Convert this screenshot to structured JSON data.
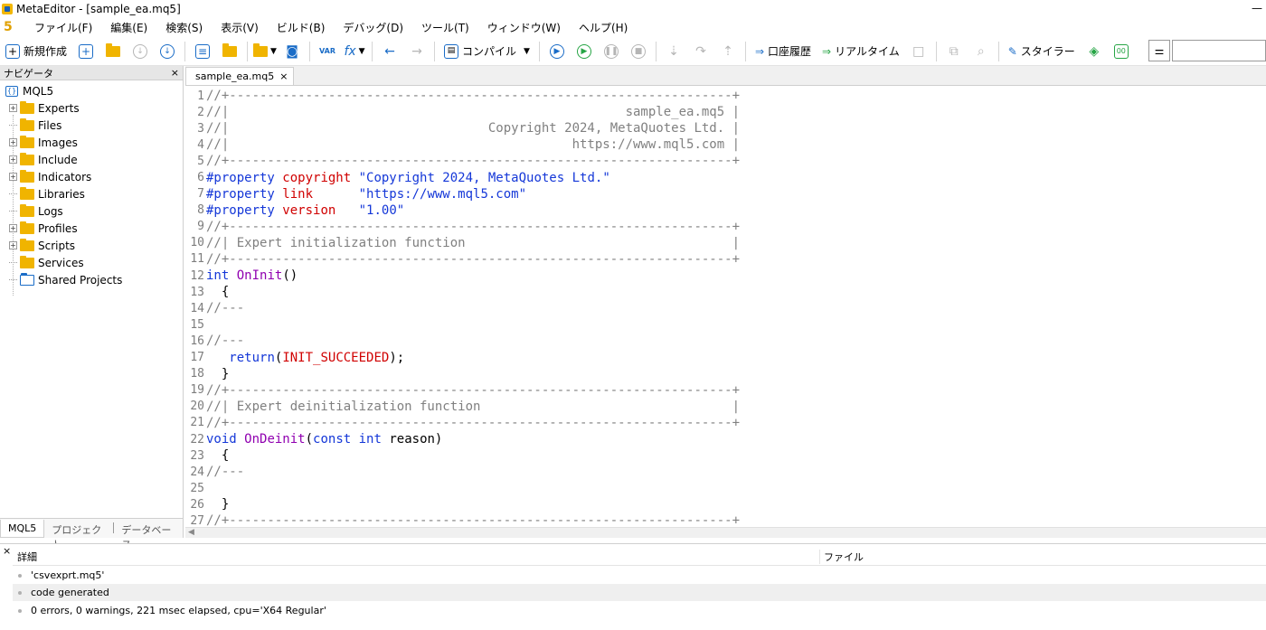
{
  "window": {
    "title": "MetaEditor - [sample_ea.mq5]",
    "minimize": "—"
  },
  "menu": [
    "ファイル(F)",
    "編集(E)",
    "検索(S)",
    "表示(V)",
    "ビルド(B)",
    "デバッグ(D)",
    "ツール(T)",
    "ウィンドウ(W)",
    "ヘルプ(H)"
  ],
  "menu_logo": "5",
  "toolbar": {
    "new_label": "新規作成",
    "compile_label": "コンパイル",
    "history_label": "口座履歴",
    "realtime_label": "リアルタイム",
    "styler_label": "スタイラー",
    "var_label": "VAR",
    "fx_label": "fx"
  },
  "navigator": {
    "title": "ナビゲータ",
    "close": "×",
    "root": "MQL5",
    "items": [
      {
        "label": "Experts",
        "expandable": true
      },
      {
        "label": "Files",
        "expandable": false
      },
      {
        "label": "Images",
        "expandable": true
      },
      {
        "label": "Include",
        "expandable": true
      },
      {
        "label": "Indicators",
        "expandable": true
      },
      {
        "label": "Libraries",
        "expandable": false
      },
      {
        "label": "Logs",
        "expandable": false
      },
      {
        "label": "Profiles",
        "expandable": true
      },
      {
        "label": "Scripts",
        "expandable": true
      },
      {
        "label": "Services",
        "expandable": false
      },
      {
        "label": "Shared Projects",
        "expandable": false
      }
    ],
    "tabs": [
      "MQL5",
      "プロジェクト",
      "データベース"
    ]
  },
  "editor": {
    "tab": "sample_ea.mq5",
    "tab_close": "×",
    "lines": [
      {
        "n": "1",
        "t": [
          [
            "c-comment",
            "//+------------------------------------------------------------------+"
          ]
        ]
      },
      {
        "n": "2",
        "t": [
          [
            "c-comment",
            "//|                                                    sample_ea.mq5 |"
          ]
        ]
      },
      {
        "n": "3",
        "t": [
          [
            "c-comment",
            "//|                                  Copyright 2024, MetaQuotes Ltd. |"
          ]
        ]
      },
      {
        "n": "4",
        "t": [
          [
            "c-comment",
            "//|                                             https://www.mql5.com |"
          ]
        ]
      },
      {
        "n": "5",
        "t": [
          [
            "c-comment",
            "//+------------------------------------------------------------------+"
          ]
        ]
      },
      {
        "n": "6",
        "t": [
          [
            "c-pp",
            "#property"
          ],
          [
            "lc",
            " "
          ],
          [
            "c-prop",
            "copyright"
          ],
          [
            "lc",
            " "
          ],
          [
            "c-str",
            "\"Copyright 2024, MetaQuotes Ltd.\""
          ]
        ]
      },
      {
        "n": "7",
        "t": [
          [
            "c-pp",
            "#property"
          ],
          [
            "lc",
            " "
          ],
          [
            "c-prop",
            "link"
          ],
          [
            "lc",
            "      "
          ],
          [
            "c-str",
            "\"https://www.mql5.com\""
          ]
        ]
      },
      {
        "n": "8",
        "t": [
          [
            "c-pp",
            "#property"
          ],
          [
            "lc",
            " "
          ],
          [
            "c-prop",
            "version"
          ],
          [
            "lc",
            "   "
          ],
          [
            "c-str",
            "\"1.00\""
          ]
        ]
      },
      {
        "n": "9",
        "t": [
          [
            "c-comment",
            "//+------------------------------------------------------------------+"
          ]
        ]
      },
      {
        "n": "10",
        "t": [
          [
            "c-comment",
            "//| Expert initialization function                                   |"
          ]
        ]
      },
      {
        "n": "11",
        "t": [
          [
            "c-comment",
            "//+------------------------------------------------------------------+"
          ]
        ]
      },
      {
        "n": "12",
        "t": [
          [
            "c-kw",
            "int"
          ],
          [
            "lc",
            " "
          ],
          [
            "c-fn",
            "OnInit"
          ],
          [
            "lc",
            "()"
          ]
        ]
      },
      {
        "n": "13",
        "t": [
          [
            "lc",
            "  {"
          ]
        ]
      },
      {
        "n": "14",
        "t": [
          [
            "c-comment",
            "//---"
          ]
        ]
      },
      {
        "n": "15",
        "t": [
          [
            "lc",
            ""
          ]
        ]
      },
      {
        "n": "16",
        "t": [
          [
            "c-comment",
            "//---"
          ]
        ]
      },
      {
        "n": "17",
        "t": [
          [
            "lc",
            "   "
          ],
          [
            "c-kw",
            "return"
          ],
          [
            "lc",
            "("
          ],
          [
            "c-const",
            "INIT_SUCCEEDED"
          ],
          [
            "lc",
            ");"
          ]
        ]
      },
      {
        "n": "18",
        "t": [
          [
            "lc",
            "  }"
          ]
        ]
      },
      {
        "n": "19",
        "t": [
          [
            "c-comment",
            "//+------------------------------------------------------------------+"
          ]
        ]
      },
      {
        "n": "20",
        "t": [
          [
            "c-comment",
            "//| Expert deinitialization function                                 |"
          ]
        ]
      },
      {
        "n": "21",
        "t": [
          [
            "c-comment",
            "//+------------------------------------------------------------------+"
          ]
        ]
      },
      {
        "n": "22",
        "t": [
          [
            "c-kw",
            "void"
          ],
          [
            "lc",
            " "
          ],
          [
            "c-fn",
            "OnDeinit"
          ],
          [
            "lc",
            "("
          ],
          [
            "c-kw",
            "const"
          ],
          [
            "lc",
            " "
          ],
          [
            "c-kw",
            "int"
          ],
          [
            "lc",
            " reason)"
          ]
        ]
      },
      {
        "n": "23",
        "t": [
          [
            "lc",
            "  {"
          ]
        ]
      },
      {
        "n": "24",
        "t": [
          [
            "c-comment",
            "//---"
          ]
        ]
      },
      {
        "n": "25",
        "t": [
          [
            "lc",
            ""
          ]
        ]
      },
      {
        "n": "26",
        "t": [
          [
            "lc",
            "  }"
          ]
        ]
      },
      {
        "n": "27",
        "t": [
          [
            "c-comment",
            "//+------------------------------------------------------------------+"
          ]
        ]
      }
    ]
  },
  "output": {
    "close": "×",
    "col_detail": "詳細",
    "col_file": "ファイル",
    "messages": [
      "'csvexprt.mq5'",
      "code generated",
      "0 errors, 0 warnings, 221 msec elapsed, cpu='X64 Regular'"
    ]
  }
}
